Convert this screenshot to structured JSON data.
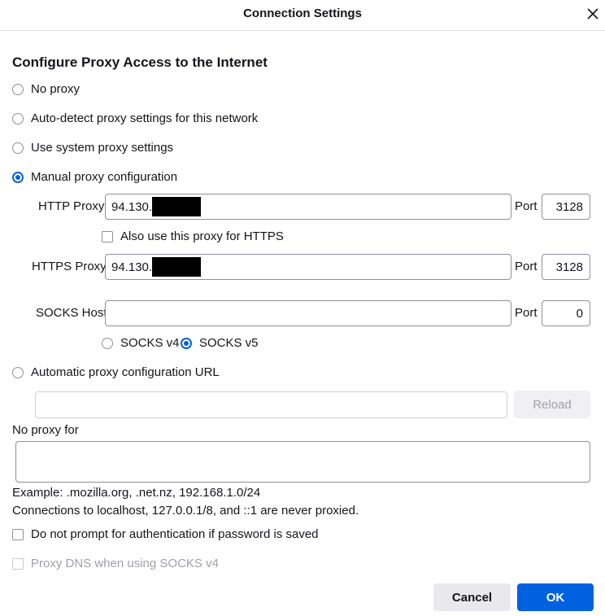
{
  "window": {
    "title": "Connection Settings",
    "close_icon": "close-icon"
  },
  "heading": "Configure Proxy Access to the Internet",
  "proxy_modes": {
    "no_proxy": "No proxy",
    "auto_detect": "Auto-detect proxy settings for this network",
    "system": "Use system proxy settings",
    "manual": "Manual proxy configuration",
    "auto_url": "Automatic proxy configuration URL",
    "selected": "manual"
  },
  "http": {
    "label": "HTTP Proxy",
    "value": "94.130.",
    "port_label": "Port",
    "port": "3128"
  },
  "also_https": {
    "label": "Also use this proxy for HTTPS",
    "checked": false
  },
  "https": {
    "label": "HTTPS Proxy",
    "value": "94.130.",
    "port_label": "Port",
    "port": "3128"
  },
  "socks": {
    "label": "SOCKS Host",
    "value": "",
    "port_label": "Port",
    "port": "0",
    "v4_label": "SOCKS v4",
    "v5_label": "SOCKS v5",
    "selected": "v5"
  },
  "auto_url": {
    "value": "",
    "reload_label": "Reload"
  },
  "no_proxy_for": {
    "label": "No proxy for",
    "value": ""
  },
  "example_text": "Example: .mozilla.org, .net.nz, 192.168.1.0/24",
  "localhost_note": "Connections to localhost, 127.0.0.1/8, and ::1 are never proxied.",
  "no_prompt_auth": {
    "label": "Do not prompt for authentication if password is saved",
    "checked": false
  },
  "proxy_dns": {
    "label": "Proxy DNS when using SOCKS v4",
    "checked": false,
    "disabled": true
  },
  "buttons": {
    "cancel": "Cancel",
    "ok": "OK"
  },
  "colors": {
    "accent": "#0061e0",
    "text": "#15141a",
    "disabled_text": "#a0a0a8"
  }
}
